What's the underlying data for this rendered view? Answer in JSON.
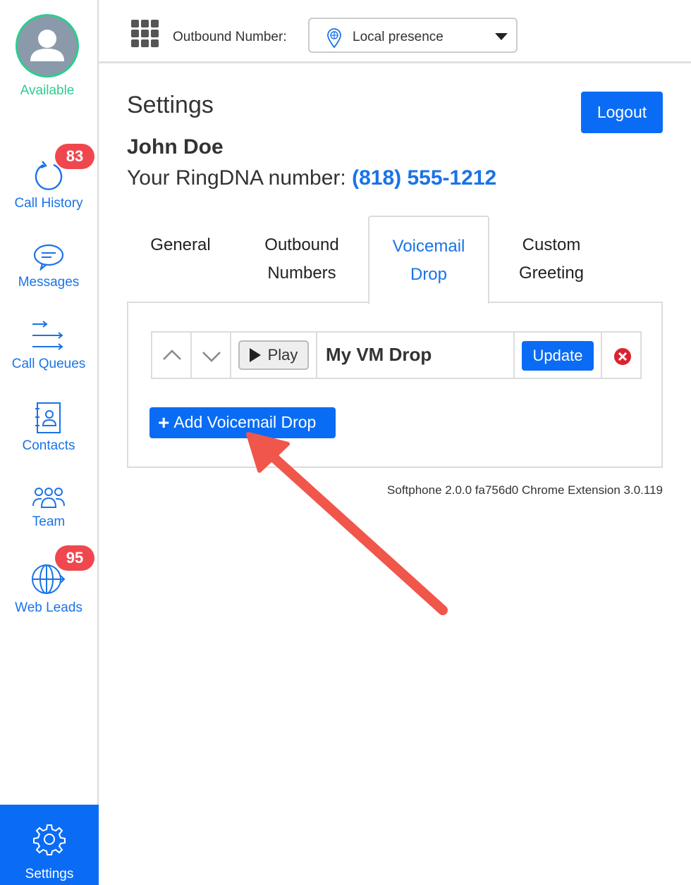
{
  "sidebar": {
    "status": "Available",
    "items": [
      {
        "label": "Call History",
        "icon": "refresh-icon",
        "badge": "83"
      },
      {
        "label": "Messages",
        "icon": "chat-icon"
      },
      {
        "label": "Call Queues",
        "icon": "queue-arrows-icon"
      },
      {
        "label": "Contacts",
        "icon": "contact-book-icon"
      },
      {
        "label": "Team",
        "icon": "team-icon"
      },
      {
        "label": "Web Leads",
        "icon": "globe-icon",
        "badge": "95"
      }
    ],
    "settings_label": "Settings",
    "settings_icon": "gear-icon"
  },
  "topbar": {
    "outbound_label": "Outbound Number:",
    "outbound_value": "Local presence",
    "icons": [
      "grid-icon",
      "location-pin-icon",
      "caret-down-icon"
    ]
  },
  "main": {
    "title": "Settings",
    "logout_label": "Logout",
    "user_name": "John Doe",
    "ring_label": "Your RingDNA number:",
    "ring_number": "(818) 555-1212",
    "tabs": [
      {
        "line1": "General",
        "line2": ""
      },
      {
        "line1": "Outbound",
        "line2": "Numbers"
      },
      {
        "line1": "Voicemail",
        "line2": "Drop"
      },
      {
        "line1": "Custom",
        "line2": "Greeting"
      }
    ],
    "active_tab": "Voicemail Drop",
    "voicemail_drops": [
      {
        "play_label": "Play",
        "name": "My VM Drop",
        "update_label": "Update"
      }
    ],
    "add_label": "Add Voicemail Drop",
    "version": "Softphone 2.0.0 fa756d0 Chrome Extension 3.0.119"
  },
  "colors": {
    "accent": "#0a6cf5",
    "link": "#1a73e8",
    "available": "#2ecc8f",
    "badge": "#f0474f",
    "annotation_arrow": "#f0564a"
  }
}
